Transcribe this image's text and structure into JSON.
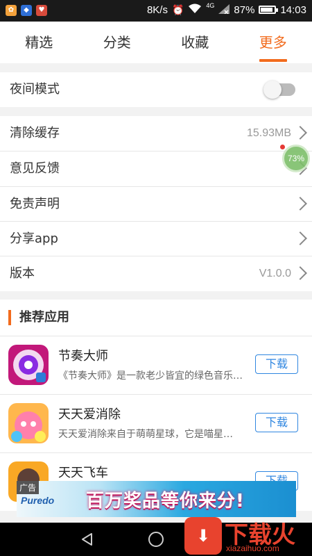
{
  "status_bar": {
    "speed": "8K/s",
    "network": "4G",
    "battery": "87%",
    "battery_level": 0.87,
    "time": "14:03"
  },
  "tabs": [
    {
      "label": "精选",
      "active": false
    },
    {
      "label": "分类",
      "active": false
    },
    {
      "label": "收藏",
      "active": false
    },
    {
      "label": "更多",
      "active": true
    }
  ],
  "settings": {
    "night_mode": {
      "label": "夜间模式",
      "enabled": false
    },
    "clear_cache": {
      "label": "清除缓存",
      "value": "15.93MB"
    },
    "feedback": {
      "label": "意见反馈"
    },
    "disclaimer": {
      "label": "免责声明"
    },
    "share": {
      "label": "分享app"
    },
    "version": {
      "label": "版本",
      "value": "V1.0.0"
    }
  },
  "floating_badge": {
    "text": "73%"
  },
  "recommended": {
    "title": "推荐应用",
    "download_label": "下载",
    "apps": [
      {
        "name": "节奏大师",
        "desc": "《节奏大师》是一款老少皆宜的绿色音乐…"
      },
      {
        "name": "天天爱消除",
        "desc": "天天爱消除来自于萌萌星球，它是喵星…"
      },
      {
        "name": "天天飞车",
        "desc": ""
      }
    ]
  },
  "ad": {
    "tag": "广告",
    "brand": "Puredo",
    "text": "百万奖品等你来分!"
  },
  "watermark": {
    "title": "下载火",
    "url": "xiazaihuo.com"
  },
  "colors": {
    "accent": "#f26b1d",
    "download_blue": "#2f86e0"
  }
}
